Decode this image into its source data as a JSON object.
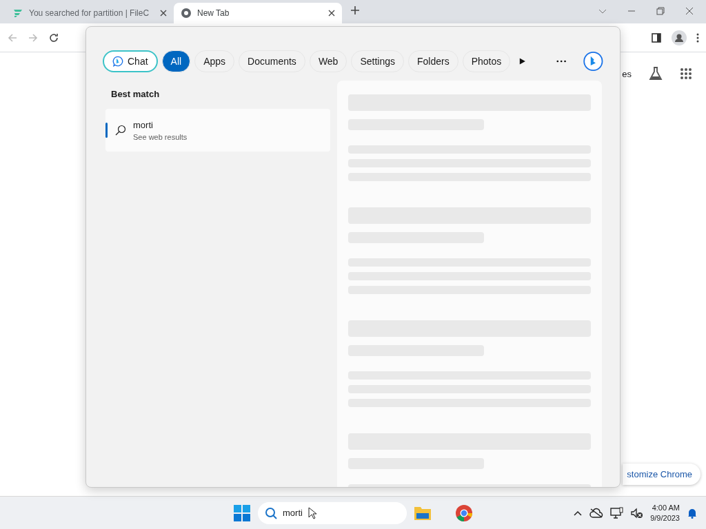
{
  "browser": {
    "tabs": [
      {
        "title": "You searched for partition | FileC",
        "selected": false
      },
      {
        "title": "New Tab",
        "selected": true
      }
    ],
    "page": {
      "partial_link": "es",
      "customize_button": "stomize Chrome"
    }
  },
  "search_flyout": {
    "filters": [
      {
        "label": "Chat",
        "kind": "chat",
        "selected": false
      },
      {
        "label": "All",
        "kind": "filter",
        "selected": true
      },
      {
        "label": "Apps",
        "kind": "filter",
        "selected": false
      },
      {
        "label": "Documents",
        "kind": "filter",
        "selected": false
      },
      {
        "label": "Web",
        "kind": "filter",
        "selected": false
      },
      {
        "label": "Settings",
        "kind": "filter",
        "selected": false
      },
      {
        "label": "Folders",
        "kind": "filter",
        "selected": false
      },
      {
        "label": "Photos",
        "kind": "filter",
        "selected": false
      }
    ],
    "section_title": "Best match",
    "results": [
      {
        "title": "morti",
        "subtitle": "See web results",
        "selected": true
      }
    ]
  },
  "taskbar": {
    "search_value": "morti",
    "time": "4:00 AM",
    "date": "9/9/2023"
  }
}
